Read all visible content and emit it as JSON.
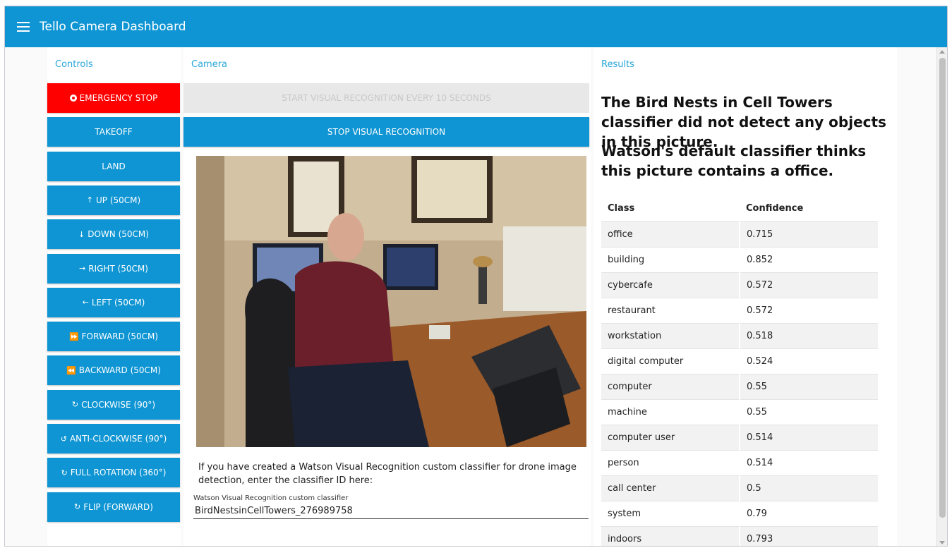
{
  "app": {
    "title": "Tello Camera Dashboard"
  },
  "controls": {
    "label": "Controls",
    "buttons": [
      {
        "label": "EMERGENCY STOP",
        "icon": "stop-circle-icon"
      },
      {
        "label": "TAKEOFF",
        "icon": ""
      },
      {
        "label": "LAND",
        "icon": ""
      },
      {
        "label": "UP (50CM)",
        "icon": "arrow-up-icon"
      },
      {
        "label": "DOWN (50CM)",
        "icon": "arrow-down-icon"
      },
      {
        "label": "RIGHT (50CM)",
        "icon": "arrow-right-icon"
      },
      {
        "label": "LEFT (50CM)",
        "icon": "arrow-left-icon"
      },
      {
        "label": "FORWARD (50CM)",
        "icon": "fast-forward-icon"
      },
      {
        "label": "BACKWARD (50CM)",
        "icon": "rewind-icon"
      },
      {
        "label": "CLOCKWISE (90°)",
        "icon": "rotate-cw-icon"
      },
      {
        "label": "ANTI-CLOCKWISE (90°)",
        "icon": "rotate-ccw-icon"
      },
      {
        "label": "FULL ROTATION (360°)",
        "icon": "rotate-cw-icon"
      },
      {
        "label": "FLIP (FORWARD)",
        "icon": "rotate-cw-icon"
      }
    ]
  },
  "camera": {
    "label": "Camera",
    "start_button": "START VISUAL RECOGNITION EVERY 10 SECONDS",
    "stop_button": "STOP VISUAL RECOGNITION",
    "instructions": "If you have created a Watson Visual Recognition custom classifier for drone image detection, enter the classifier ID here:",
    "classifier_field": {
      "label": "Watson Visual Recognition custom classifier",
      "value": "BirdNestsinCellTowers_276989758"
    }
  },
  "results": {
    "label": "Results",
    "custom_message": "The Bird Nests in Cell Towers classifier did not detect any objects in this picture.",
    "default_message": "Watson's default classifier thinks this picture contains a office.",
    "table": {
      "headers": [
        "Class",
        "Confidence"
      ],
      "rows": [
        [
          "office",
          "0.715"
        ],
        [
          "building",
          "0.852"
        ],
        [
          "cybercafe",
          "0.572"
        ],
        [
          "restaurant",
          "0.572"
        ],
        [
          "workstation",
          "0.518"
        ],
        [
          "digital computer",
          "0.524"
        ],
        [
          "computer",
          "0.55"
        ],
        [
          "machine",
          "0.55"
        ],
        [
          "computer user",
          "0.514"
        ],
        [
          "person",
          "0.514"
        ],
        [
          "call center",
          "0.5"
        ],
        [
          "system",
          "0.79"
        ],
        [
          "indoors",
          "0.793"
        ]
      ]
    }
  },
  "colors": {
    "primary": "#0f95d3",
    "danger": "#ff0000",
    "accent_label": "#2aa6d9"
  }
}
